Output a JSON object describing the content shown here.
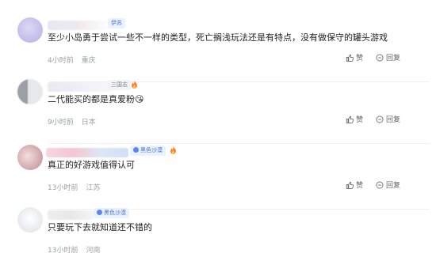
{
  "comments": [
    {
      "tag": "伊苏",
      "content": "至少小岛勇于尝试一些不一样的类型，死亡搁浅玩法还是有特点，没有做保守的罐头游戏",
      "time": "4小时前",
      "location": "重庆"
    },
    {
      "tag": "三国志",
      "content": "二代能买的都是真爱粉",
      "emoji": "😘",
      "time": "9小时前",
      "location": "日本"
    },
    {
      "tag": "黑色沙漠",
      "content": "真正的好游戏值得认可",
      "time": "13小时前",
      "location": "江苏"
    },
    {
      "tag": "黑色沙漠",
      "content": "只要玩下去就知道还不错的",
      "time": "13小时前",
      "location": "河南"
    }
  ],
  "actions": {
    "like": "赞",
    "reply": "回复"
  }
}
